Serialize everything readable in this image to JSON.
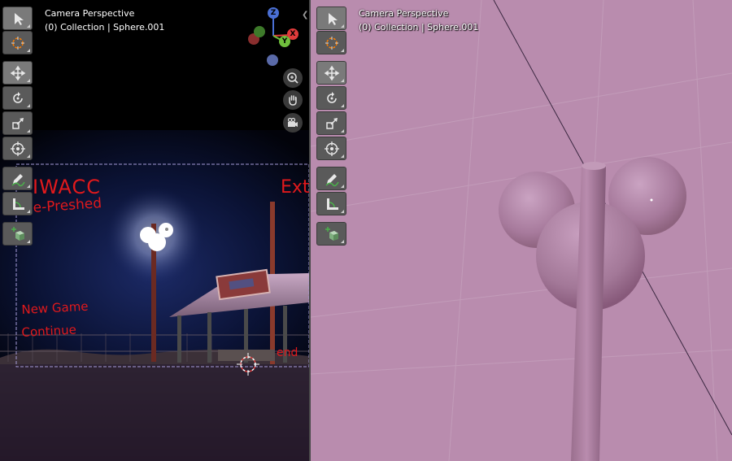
{
  "left_viewport": {
    "header": {
      "line1": "Camera Perspective",
      "line2": "(0) Collection | Sphere.001"
    },
    "gizmo": {
      "z_label": "Z",
      "x_label": "X",
      "y_label": "Y"
    },
    "annotations": {
      "text1": "IWACC",
      "text2": "e-Preshed",
      "text3": "New Game",
      "text4": "Continue",
      "text5": "Ext",
      "text6": "end"
    }
  },
  "right_viewport": {
    "header": {
      "line1": "Camera Perspective",
      "line2": "(0) Collection | Sphere.001"
    }
  },
  "toolbar": {
    "tools": [
      {
        "name": "select-box-tool",
        "icon": "cursor-icon",
        "active": true
      },
      {
        "name": "cursor-tool",
        "icon": "3d-cursor-icon",
        "active": false
      },
      {
        "name": "move-tool",
        "icon": "move-icon",
        "active": true
      },
      {
        "name": "rotate-tool",
        "icon": "rotate-icon",
        "active": false
      },
      {
        "name": "scale-tool",
        "icon": "scale-icon",
        "active": false
      },
      {
        "name": "transform-tool",
        "icon": "transform-icon",
        "active": false
      },
      {
        "name": "annotate-tool",
        "icon": "pencil-icon",
        "active": false
      },
      {
        "name": "measure-tool",
        "icon": "ruler-icon",
        "active": false
      },
      {
        "name": "add-cube-tool",
        "icon": "add-cube-icon",
        "active": false
      }
    ]
  },
  "colors": {
    "accent": "#ff7f00",
    "material_pink": "#b98cae",
    "axis_x": "#e03b3b",
    "axis_y": "#6fbf3c",
    "axis_z": "#4a6fd4",
    "annotation_red": "#e0191c"
  }
}
